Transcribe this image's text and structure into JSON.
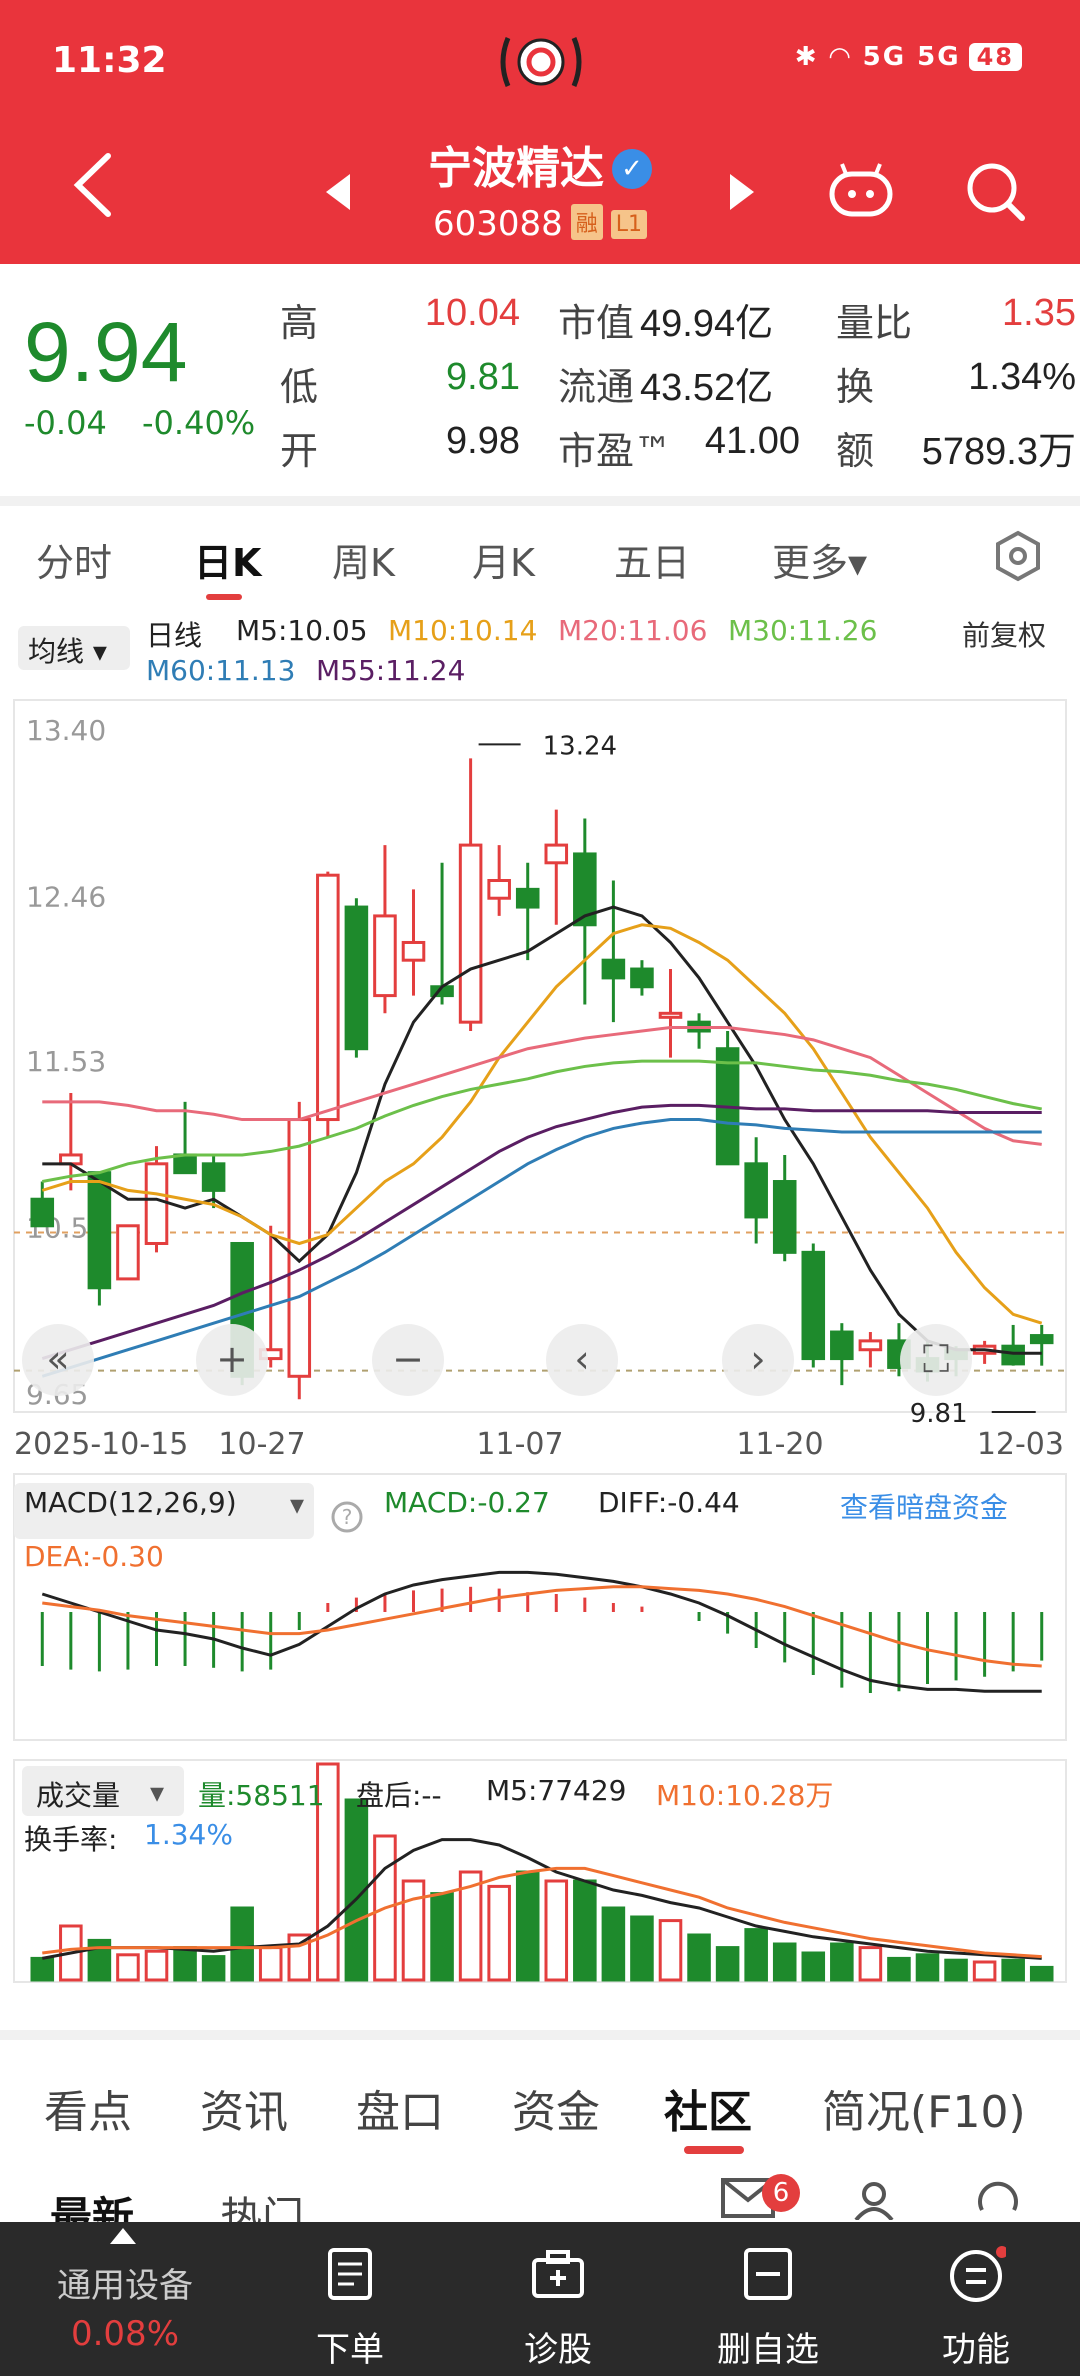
{
  "status_bar": {
    "time": "11:32",
    "network": "5G 5G",
    "battery": "48"
  },
  "header": {
    "stock_name": "宁波精达",
    "stock_code": "603088",
    "tag_margin": "融",
    "tag_level": "L1",
    "colors": {
      "header_bg": "#e9343c",
      "up": "#e33e3e",
      "down": "#1e8a2c"
    }
  },
  "quote": {
    "price": "9.94",
    "change": "-0.04",
    "change_pct": "-0.40%",
    "high_label": "高",
    "high": "10.04",
    "low_label": "低",
    "low": "9.81",
    "open_label": "开",
    "open": "9.98",
    "mcap_label": "市值",
    "mcap": "49.94亿",
    "float_label": "流通",
    "float": "43.52亿",
    "pe_label": "市盈™",
    "pe": "41.00",
    "vol_ratio_label": "量比",
    "vol_ratio": "1.35",
    "turnover_label": "换",
    "turnover": "1.34%",
    "amount_label": "额",
    "amount": "5789.3万"
  },
  "kline_tabs": [
    "分时",
    "日K",
    "周K",
    "月K",
    "五日",
    "更多▾"
  ],
  "ma_legend": {
    "select": "均线",
    "period": "日线",
    "m5": "M5:10.05",
    "m10": "M10:10.14",
    "m20": "M20:11.06",
    "m30": "M30:11.26",
    "m60": "M60:11.13",
    "m55": "M55:11.24",
    "adjust": "前复权"
  },
  "chart_data": {
    "type": "candlestick",
    "y_ticks": [
      "13.40",
      "12.46",
      "11.53",
      "10.59",
      "9.65"
    ],
    "ylim": [
      9.65,
      13.4
    ],
    "x_ticks": [
      "2025-10-15",
      "10-27",
      "11-07",
      "11-20",
      "12-03"
    ],
    "annotations": {
      "max": "13.24",
      "min": "9.81"
    },
    "candles": [
      {
        "o": 10.75,
        "h": 10.85,
        "l": 10.6,
        "c": 10.6
      },
      {
        "o": 10.95,
        "h": 11.35,
        "l": 10.8,
        "c": 11.0
      },
      {
        "o": 10.9,
        "h": 10.9,
        "l": 10.15,
        "c": 10.25
      },
      {
        "o": 10.3,
        "h": 10.6,
        "l": 10.3,
        "c": 10.6
      },
      {
        "o": 10.5,
        "h": 11.05,
        "l": 10.45,
        "c": 10.95
      },
      {
        "o": 11.0,
        "h": 11.3,
        "l": 10.95,
        "c": 10.9
      },
      {
        "o": 10.95,
        "h": 11.0,
        "l": 10.7,
        "c": 10.8
      },
      {
        "o": 10.5,
        "h": 10.5,
        "l": 9.7,
        "c": 9.75
      },
      {
        "o": 9.85,
        "h": 10.6,
        "l": 9.8,
        "c": 9.9
      },
      {
        "o": 9.75,
        "h": 11.3,
        "l": 9.62,
        "c": 11.2
      },
      {
        "o": 11.2,
        "h": 12.6,
        "l": 11.1,
        "c": 12.58
      },
      {
        "o": 12.4,
        "h": 12.45,
        "l": 11.55,
        "c": 11.6
      },
      {
        "o": 11.9,
        "h": 12.75,
        "l": 11.8,
        "c": 12.35
      },
      {
        "o": 12.1,
        "h": 12.5,
        "l": 11.9,
        "c": 12.2
      },
      {
        "o": 11.95,
        "h": 12.65,
        "l": 11.85,
        "c": 11.9
      },
      {
        "o": 11.75,
        "h": 13.24,
        "l": 11.7,
        "c": 12.75
      },
      {
        "o": 12.45,
        "h": 12.75,
        "l": 12.35,
        "c": 12.55
      },
      {
        "o": 12.5,
        "h": 12.65,
        "l": 12.1,
        "c": 12.4
      },
      {
        "o": 12.65,
        "h": 12.95,
        "l": 12.3,
        "c": 12.75
      },
      {
        "o": 12.7,
        "h": 12.9,
        "l": 11.85,
        "c": 12.3
      },
      {
        "o": 12.1,
        "h": 12.55,
        "l": 11.75,
        "c": 12.0
      },
      {
        "o": 12.05,
        "h": 12.1,
        "l": 11.9,
        "c": 11.95
      },
      {
        "o": 11.8,
        "h": 12.05,
        "l": 11.55,
        "c": 11.8
      },
      {
        "o": 11.75,
        "h": 11.8,
        "l": 11.6,
        "c": 11.7
      },
      {
        "o": 11.6,
        "h": 11.7,
        "l": 10.95,
        "c": 10.95
      },
      {
        "o": 10.95,
        "h": 11.1,
        "l": 10.5,
        "c": 10.65
      },
      {
        "o": 10.85,
        "h": 11.0,
        "l": 10.4,
        "c": 10.45
      },
      {
        "o": 10.45,
        "h": 10.5,
        "l": 9.8,
        "c": 9.85
      },
      {
        "o": 10.0,
        "h": 10.05,
        "l": 9.7,
        "c": 9.85
      },
      {
        "o": 9.9,
        "h": 10.0,
        "l": 9.8,
        "c": 9.95
      },
      {
        "o": 9.95,
        "h": 10.05,
        "l": 9.75,
        "c": 9.8
      },
      {
        "o": 9.85,
        "h": 9.95,
        "l": 9.72,
        "c": 9.78
      },
      {
        "o": 9.9,
        "h": 9.92,
        "l": 9.75,
        "c": 9.85
      },
      {
        "o": 9.88,
        "h": 9.95,
        "l": 9.82,
        "c": 9.92
      },
      {
        "o": 9.92,
        "h": 10.04,
        "l": 9.81,
        "c": 9.82
      },
      {
        "o": 9.98,
        "h": 10.04,
        "l": 9.81,
        "c": 9.94
      }
    ],
    "series": [
      {
        "name": "M5",
        "color": "#222222",
        "values": [
          10.95,
          10.95,
          10.85,
          10.75,
          10.75,
          10.7,
          10.75,
          10.65,
          10.55,
          10.4,
          10.55,
          10.9,
          11.4,
          11.75,
          11.95,
          12.05,
          12.1,
          12.15,
          12.25,
          12.35,
          12.4,
          12.35,
          12.2,
          12.0,
          11.75,
          11.5,
          11.2,
          10.95,
          10.65,
          10.35,
          10.1,
          9.95,
          9.9,
          9.9,
          9.88,
          9.88
        ]
      },
      {
        "name": "M10",
        "color": "#e6a019",
        "values": [
          10.8,
          10.85,
          10.85,
          10.8,
          10.78,
          10.75,
          10.72,
          10.65,
          10.55,
          10.5,
          10.55,
          10.7,
          10.85,
          10.95,
          11.1,
          11.3,
          11.55,
          11.75,
          11.95,
          12.1,
          12.25,
          12.3,
          12.28,
          12.2,
          12.1,
          11.95,
          11.8,
          11.6,
          11.35,
          11.1,
          10.9,
          10.7,
          10.45,
          10.25,
          10.1,
          10.05
        ]
      },
      {
        "name": "M20",
        "color": "#e86a7a",
        "values": [
          11.3,
          11.3,
          11.3,
          11.28,
          11.25,
          11.25,
          11.23,
          11.2,
          11.2,
          11.2,
          11.25,
          11.3,
          11.35,
          11.4,
          11.45,
          11.5,
          11.55,
          11.6,
          11.63,
          11.66,
          11.68,
          11.7,
          11.72,
          11.72,
          11.72,
          11.7,
          11.68,
          11.65,
          11.6,
          11.55,
          11.45,
          11.35,
          11.25,
          11.15,
          11.08,
          11.06
        ]
      },
      {
        "name": "M30",
        "color": "#6cc04a",
        "values": [
          10.85,
          10.88,
          10.9,
          10.95,
          10.98,
          11.0,
          11.0,
          11.0,
          11.02,
          11.05,
          11.1,
          11.15,
          11.22,
          11.28,
          11.33,
          11.37,
          11.4,
          11.43,
          11.47,
          11.5,
          11.52,
          11.53,
          11.53,
          11.53,
          11.52,
          11.52,
          11.5,
          11.48,
          11.47,
          11.45,
          11.42,
          11.4,
          11.37,
          11.33,
          11.29,
          11.26
        ]
      },
      {
        "name": "M60",
        "color": "#2f7db5",
        "values": [
          9.75,
          9.8,
          9.85,
          9.9,
          9.95,
          10.0,
          10.05,
          10.1,
          10.15,
          10.2,
          10.28,
          10.36,
          10.45,
          10.55,
          10.65,
          10.75,
          10.85,
          10.95,
          11.03,
          11.1,
          11.15,
          11.18,
          11.2,
          11.2,
          11.18,
          11.17,
          11.15,
          11.14,
          11.13,
          11.13,
          11.13,
          11.13,
          11.13,
          11.13,
          11.13,
          11.13
        ]
      },
      {
        "name": "M55",
        "color": "#5a1e63",
        "values": [
          9.85,
          9.9,
          9.95,
          10.0,
          10.05,
          10.1,
          10.15,
          10.22,
          10.28,
          10.35,
          10.43,
          10.52,
          10.62,
          10.72,
          10.82,
          10.92,
          11.02,
          11.1,
          11.16,
          11.2,
          11.24,
          11.27,
          11.28,
          11.28,
          11.27,
          11.26,
          11.26,
          11.25,
          11.25,
          11.25,
          11.25,
          11.25,
          11.24,
          11.24,
          11.24,
          11.24
        ]
      }
    ],
    "macd_label": "MACD(12,26,9)",
    "macd": "MACD:-0.27",
    "diff": "DIFF:-0.44",
    "dea": "DEA:-0.30",
    "macd_link": "查看暗盘资金",
    "macd_hist": [
      -0.3,
      -0.32,
      -0.33,
      -0.32,
      -0.3,
      -0.3,
      -0.31,
      -0.33,
      -0.32,
      -0.1,
      0.05,
      0.08,
      0.1,
      0.12,
      0.13,
      0.14,
      0.13,
      0.11,
      0.1,
      0.08,
      0.05,
      0.03,
      0.0,
      -0.05,
      -0.12,
      -0.2,
      -0.28,
      -0.35,
      -0.42,
      -0.45,
      -0.44,
      -0.4,
      -0.38,
      -0.36,
      -0.33,
      -0.27
    ],
    "diff_line": [
      0.1,
      0.05,
      0.0,
      -0.05,
      -0.1,
      -0.12,
      -0.15,
      -0.2,
      -0.24,
      -0.18,
      -0.08,
      0.02,
      0.1,
      0.15,
      0.18,
      0.2,
      0.22,
      0.22,
      0.21,
      0.19,
      0.17,
      0.14,
      0.1,
      0.05,
      -0.02,
      -0.1,
      -0.18,
      -0.25,
      -0.32,
      -0.38,
      -0.41,
      -0.43,
      -0.43,
      -0.44,
      -0.44,
      -0.44
    ],
    "dea_line": [
      0.05,
      0.03,
      0.01,
      -0.02,
      -0.04,
      -0.06,
      -0.08,
      -0.1,
      -0.12,
      -0.12,
      -0.1,
      -0.07,
      -0.04,
      -0.01,
      0.02,
      0.05,
      0.08,
      0.1,
      0.12,
      0.13,
      0.14,
      0.14,
      0.13,
      0.12,
      0.1,
      0.07,
      0.03,
      -0.02,
      -0.07,
      -0.12,
      -0.17,
      -0.21,
      -0.24,
      -0.27,
      -0.29,
      -0.3
    ],
    "volume_label": "成交量",
    "volume": "量:58511",
    "after_hours": "盘后:--",
    "vol_m5": "M5:77429",
    "vol_m10": "M10:10.28万",
    "turnover_rate_label": "换手率:",
    "turnover_rate": "1.34%",
    "volumes": [
      0.12,
      0.3,
      0.22,
      0.14,
      0.16,
      0.18,
      0.13,
      0.4,
      0.18,
      0.25,
      1.2,
      1.0,
      0.8,
      0.55,
      0.48,
      0.6,
      0.52,
      0.6,
      0.55,
      0.55,
      0.4,
      0.35,
      0.33,
      0.25,
      0.18,
      0.28,
      0.2,
      0.15,
      0.2,
      0.18,
      0.12,
      0.14,
      0.11,
      0.1,
      0.11,
      0.07
    ],
    "vol_ma1": [
      0.12,
      0.15,
      0.18,
      0.18,
      0.18,
      0.17,
      0.16,
      0.18,
      0.19,
      0.2,
      0.3,
      0.45,
      0.62,
      0.72,
      0.78,
      0.78,
      0.75,
      0.68,
      0.6,
      0.55,
      0.5,
      0.47,
      0.43,
      0.4,
      0.35,
      0.3,
      0.27,
      0.24,
      0.22,
      0.2,
      0.18,
      0.16,
      0.15,
      0.14,
      0.13,
      0.12
    ],
    "vol_ma2": [
      0.15,
      0.17,
      0.18,
      0.18,
      0.18,
      0.18,
      0.18,
      0.18,
      0.18,
      0.19,
      0.25,
      0.33,
      0.4,
      0.45,
      0.48,
      0.52,
      0.57,
      0.6,
      0.62,
      0.62,
      0.58,
      0.54,
      0.5,
      0.46,
      0.4,
      0.36,
      0.32,
      0.29,
      0.26,
      0.23,
      0.21,
      0.19,
      0.17,
      0.15,
      0.14,
      0.13
    ]
  },
  "bottom_tabs": [
    "看点",
    "资讯",
    "盘口",
    "资金",
    "社区",
    "简况(F10)"
  ],
  "sub_tabs": [
    "最新",
    "热门"
  ],
  "mail_badge": "6",
  "toolbar": {
    "device_label": "通用设备",
    "device_pct": "0.08%",
    "order": "下单",
    "diagnose": "诊股",
    "remove_fav": "删自选",
    "functions": "功能"
  }
}
